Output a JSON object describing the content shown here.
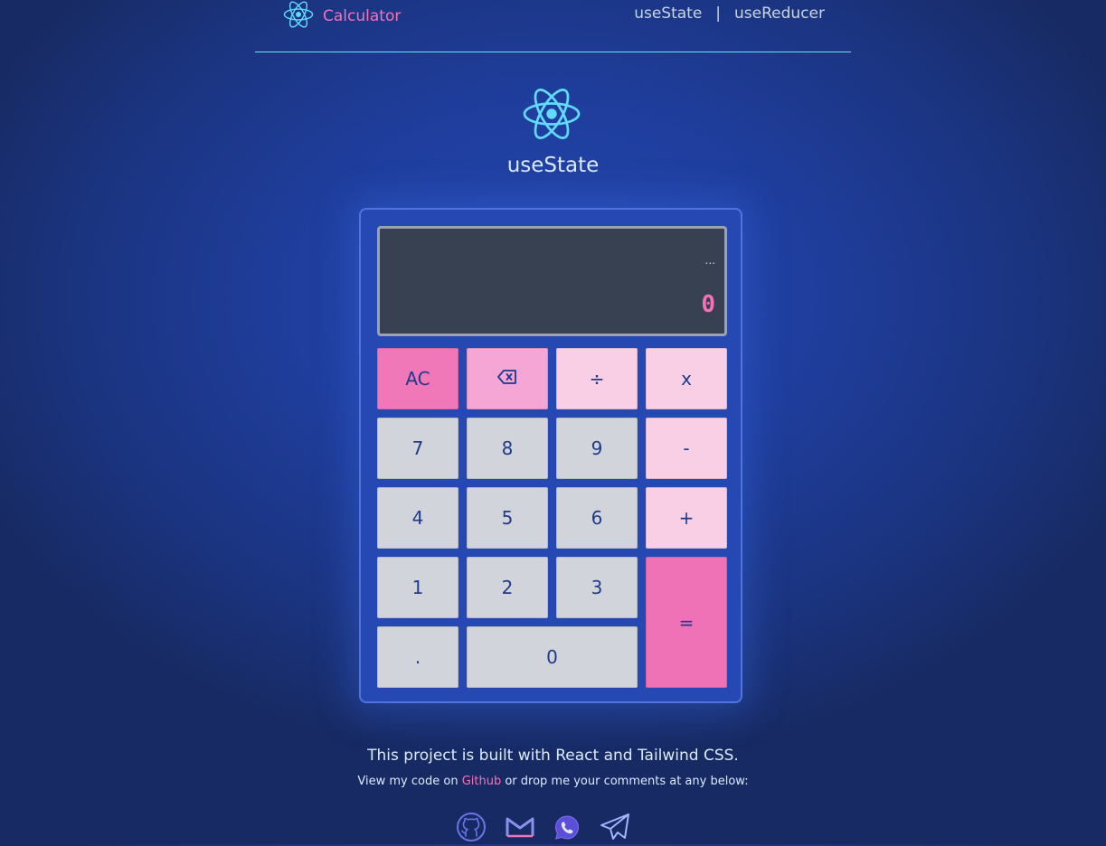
{
  "nav": {
    "brand_label": "Calculator",
    "links": [
      "useState",
      "useReducer"
    ],
    "separator": "|"
  },
  "hero": {
    "title": "useState"
  },
  "display": {
    "previous": "...",
    "current": "0"
  },
  "keys": {
    "ac": "AC",
    "divide": "÷",
    "multiply": "x",
    "seven": "7",
    "eight": "8",
    "nine": "9",
    "minus": "-",
    "four": "4",
    "five": "5",
    "six": "6",
    "plus": "+",
    "one": "1",
    "two": "2",
    "three": "3",
    "equals": "=",
    "dot": ".",
    "zero": "0"
  },
  "icons": {
    "brand": "react-logo-icon",
    "hero": "react-logo-icon",
    "delete": "backspace-icon",
    "footer": [
      "github-icon",
      "gmail-icon",
      "whatsapp-icon",
      "telegram-icon"
    ]
  },
  "footer": {
    "line1": "This project is built with React and Tailwind CSS.",
    "line2_prefix": "View my code on ",
    "line2_link": "Github",
    "line2_suffix": " or drop me your comments at any below:"
  },
  "colors": {
    "accent_pink": "#f472b6",
    "react_cyan": "#61dafb",
    "button_gray": "#d1d5db",
    "operator_pink": "#f9cfe5",
    "display_bg": "#374151"
  }
}
